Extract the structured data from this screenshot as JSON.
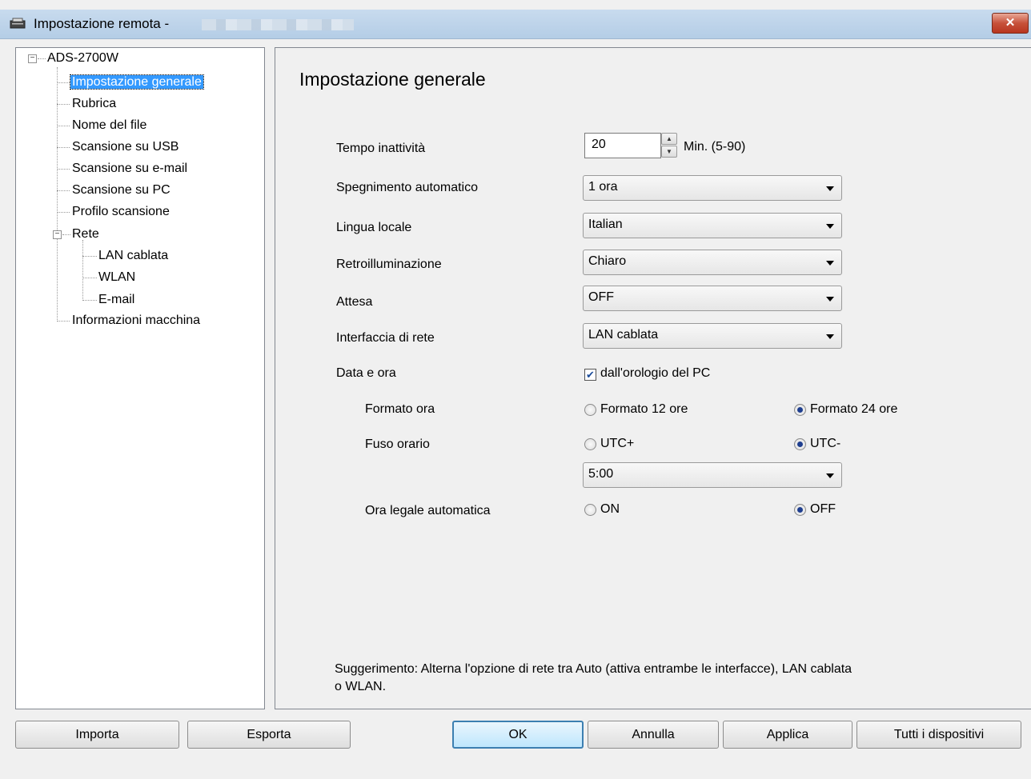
{
  "window": {
    "title": "Impostazione remota -",
    "close_label": "✕"
  },
  "tree": {
    "root": "ADS-2700W",
    "items": [
      "Impostazione generale",
      "Rubrica",
      "Nome del file",
      "Scansione su USB",
      "Scansione su e-mail",
      "Scansione su PC",
      "Profilo scansione",
      "Rete",
      "LAN cablata",
      "WLAN",
      "E-mail",
      "Informazioni macchina"
    ],
    "selected": "Impostazione generale"
  },
  "panel": {
    "title": "Impostazione generale",
    "idle_time": {
      "label": "Tempo inattività",
      "value": "20",
      "unit": "Min. (5-90)"
    },
    "auto_off": {
      "label": "Spegnimento automatico",
      "value": "1 ora"
    },
    "language": {
      "label": "Lingua locale",
      "value": "Italian"
    },
    "backlight": {
      "label": "Retroilluminazione",
      "value": "Chiaro"
    },
    "sleep": {
      "label": "Attesa",
      "value": "OFF"
    },
    "network_iface": {
      "label": "Interfaccia di rete",
      "value": "LAN cablata"
    },
    "datetime": {
      "label": "Data e ora",
      "checkbox_label": "dall'orologio del PC",
      "checked": true
    },
    "time_format": {
      "label": "Formato ora",
      "option_a": "Formato 12 ore",
      "option_b": "Formato 24 ore",
      "selected": "b"
    },
    "timezone": {
      "label": "Fuso orario",
      "option_a": "UTC+",
      "option_b": "UTC-",
      "selected": "b",
      "value": "5:00"
    },
    "dst": {
      "label": "Ora legale automatica",
      "option_a": "ON",
      "option_b": "OFF",
      "selected": "b"
    },
    "hint_line1": "Suggerimento: Alterna l'opzione di rete tra Auto (attiva entrambe le interfacce), LAN cablata",
    "hint_line2": "o WLAN."
  },
  "buttons": {
    "import": "Importa",
    "export": "Esporta",
    "ok": "OK",
    "cancel": "Annulla",
    "apply": "Applica",
    "all_devices": "Tutti i dispositivi"
  },
  "colors": {
    "selection": "#3399ff",
    "titlebar": "#b4cde6",
    "close": "#c7513a"
  }
}
